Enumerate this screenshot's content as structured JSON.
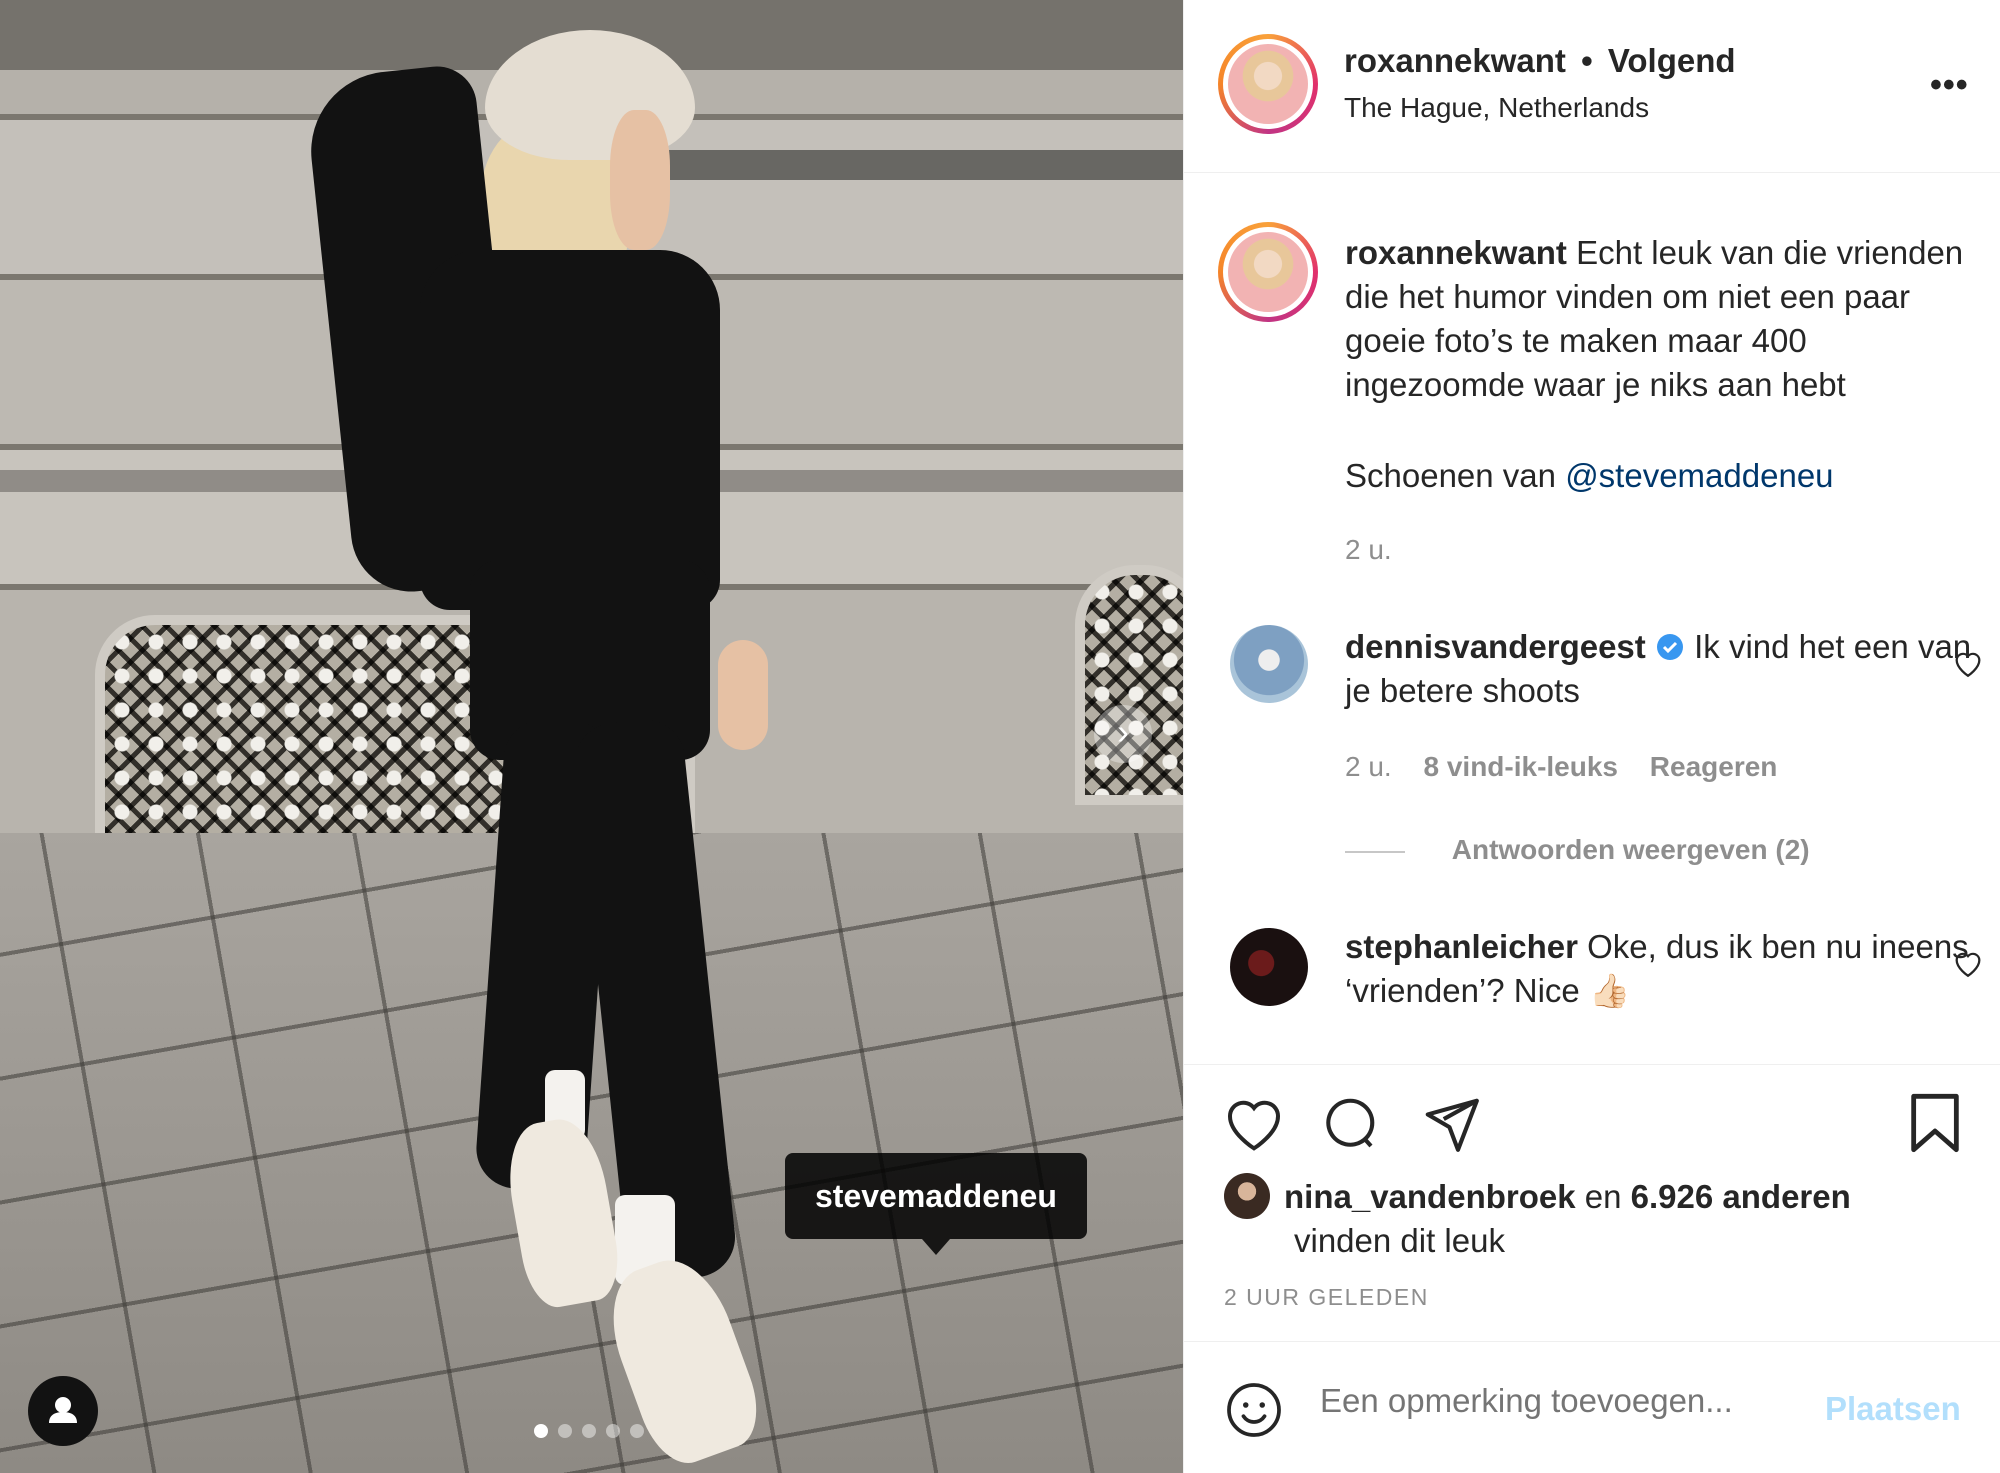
{
  "photo": {
    "tag_label": "stevemaddeneu",
    "carousel_dots": 5,
    "carousel_active": 0,
    "next_glyph": "›"
  },
  "header": {
    "username": "roxannekwant",
    "separator": "•",
    "follow_state": "Volgend",
    "location": "The Hague, Netherlands",
    "more_glyph": "•••"
  },
  "caption": {
    "username": "roxannekwant",
    "text": "Echt leuk van die vrienden die het humor vinden om niet een paar goeie foto’s te maken maar 400 ingezoomde waar je niks aan hebt",
    "shoes_text": "Schoenen van",
    "mention": "@stevemaddeneu",
    "time": "2 u."
  },
  "comments": [
    {
      "username": "dennisvandergeest",
      "verified": true,
      "text": "Ik vind het een van je betere shoots",
      "time": "2 u.",
      "likes": "8 vind-ik-leuks",
      "reply": "Reageren",
      "view_replies": "Antwoorden weergeven (2)"
    },
    {
      "username": "stephanleicher",
      "verified": false,
      "text": "Oke, dus ik ben nu ineens ‘vrienden’? Nice",
      "emoji": "👍🏻"
    }
  ],
  "likes": {
    "user": "nina_vandenbroek",
    "connector": "en",
    "others": "6.926 anderen",
    "suffix": "vinden dit leuk"
  },
  "post_time": "2 UUR GELEDEN",
  "add_comment": {
    "placeholder": "Een opmerking toevoegen...",
    "post_label": "Plaatsen"
  },
  "icons": [
    "heart-icon",
    "comment-icon",
    "share-icon",
    "bookmark-icon",
    "emoji-icon",
    "more-icon",
    "verified-icon",
    "user-tags-icon"
  ],
  "colors": {
    "link": "#00376b",
    "muted": "#8e8e8e",
    "post_disabled": "#b2dffc",
    "verified": "#3897f0"
  }
}
